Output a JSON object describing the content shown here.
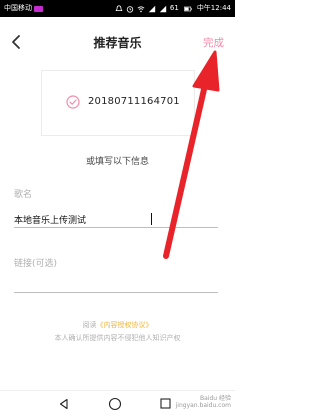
{
  "status_bar": {
    "carrier": "中国移动",
    "battery_percent": "61",
    "time": "中午12:44"
  },
  "header": {
    "title": "推荐音乐",
    "done_label": "完成"
  },
  "selected_song": {
    "id": "20180711164701"
  },
  "form": {
    "or_fill_text": "或填写以下信息",
    "name_label": "歌名",
    "name_value": "本地音乐上传测试",
    "link_label": "链接(可选)",
    "link_value": ""
  },
  "agreement": {
    "prefix": "阅读",
    "link_text": "《内容授权协议》",
    "note": "本人确认所提供内容不侵犯他人知识产权"
  },
  "watermark": {
    "line1": "Baidu 经验",
    "line2": "jingyan.baidu.com"
  },
  "colors": {
    "accent_pink": "#f48aa8",
    "link_yellow": "#f1b53a",
    "annotation_red": "#e8242a"
  }
}
